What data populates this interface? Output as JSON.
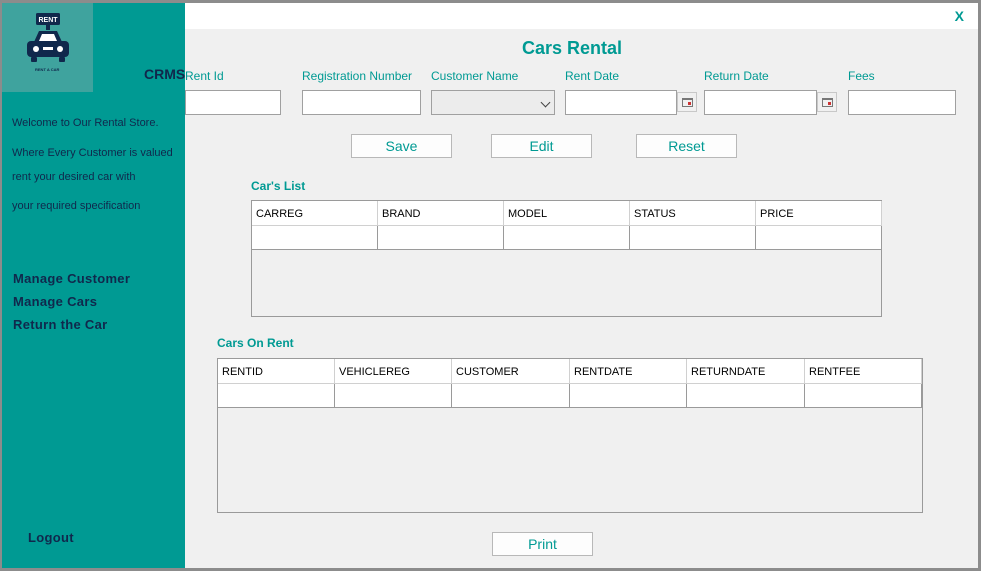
{
  "app": {
    "title": "Cars Rental",
    "close_label": "X",
    "brand": "CRMS",
    "logo_top_text": "RENT",
    "logo_bottom_text": "RENT A CAR"
  },
  "sidebar": {
    "welcome_lines": [
      "Welcome to Our Rental Store.",
      "Where Every Customer is valued",
      "rent your desired car with",
      "your required specification"
    ],
    "nav_items": [
      "Manage Customer",
      "Manage Cars",
      "Return the Car"
    ],
    "logout": "Logout"
  },
  "form": {
    "labels": [
      "Rent Id",
      "Registration Number",
      "Customer Name",
      "Rent Date",
      "Return Date",
      "Fees"
    ],
    "values": {
      "rent_id": "",
      "registration_number": "",
      "customer_name": "",
      "rent_date": "",
      "return_date": "",
      "fees": ""
    }
  },
  "buttons": {
    "save": "Save",
    "edit": "Edit",
    "reset": "Reset",
    "print": "Print"
  },
  "cars_list": {
    "title": "Car's List",
    "columns": [
      "CARREG",
      "BRAND",
      "MODEL",
      "STATUS",
      "PRICE"
    ]
  },
  "cars_on_rent": {
    "title": "Cars On Rent",
    "columns": [
      "RENTID",
      "VEHICLEREG",
      "CUSTOMER",
      "RENTDATE",
      "RETURNDATE",
      "RENTFEE"
    ]
  },
  "colors": {
    "accent": "#009a93",
    "sidebar": "#009a93",
    "nav_text": "#10284c"
  },
  "icons": [
    "car-logo-icon",
    "chevron-down-icon",
    "calendar-icon"
  ]
}
